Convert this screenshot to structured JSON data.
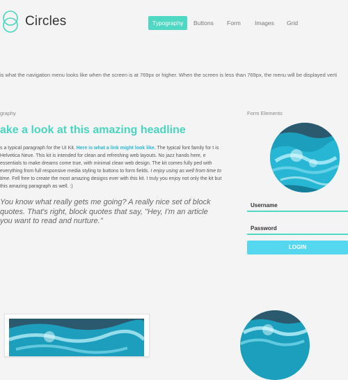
{
  "brand": {
    "name": "Circles"
  },
  "nav": {
    "items": [
      {
        "label": "Typography",
        "active": true
      },
      {
        "label": "Buttons",
        "active": false
      },
      {
        "label": "Form",
        "active": false
      },
      {
        "label": "Images",
        "active": false
      },
      {
        "label": "Grid",
        "active": false
      }
    ]
  },
  "notice": "is what the navigation menu looks like when the screen is at 769px or higher. When the screen is less than 769px, the menu will be displayed verti",
  "typography": {
    "section_label": "graphy",
    "headline": "ake a look at this amazing headline",
    "para_1": "s a typical paragraph for the UI Kit. ",
    "para_link": "Here is what a link might look like.",
    "para_2": " The typical font family for t is Helvetica Neue. This kit is intended for clean and refreshing web layouts. No jazz hands here, e essentials to make dreams come true, with minimal clean web design. The kit comes fully ped with everything from full responsive media styling to buttons to form fields. ",
    "para_italic": "I enjoy using as well from time to time.",
    "para_3": " Fell free to create the most amazing designs ever with this kit. I truly you enjoy not only the kit but this amazing paragraph as well. :)",
    "quote": "You know what really gets me going? A really nice set of block quotes. That's right, block quotes that say, \"Hey, I'm an article you want to read and nurture.\""
  },
  "form": {
    "section_label": "Form Elements",
    "username_label": "Username",
    "password_label": "Password",
    "login_label": "LOGIN"
  },
  "colors": {
    "accent_teal": "#4fd8c3",
    "accent_blue": "#56d7f0",
    "link": "#2bb8d6"
  }
}
